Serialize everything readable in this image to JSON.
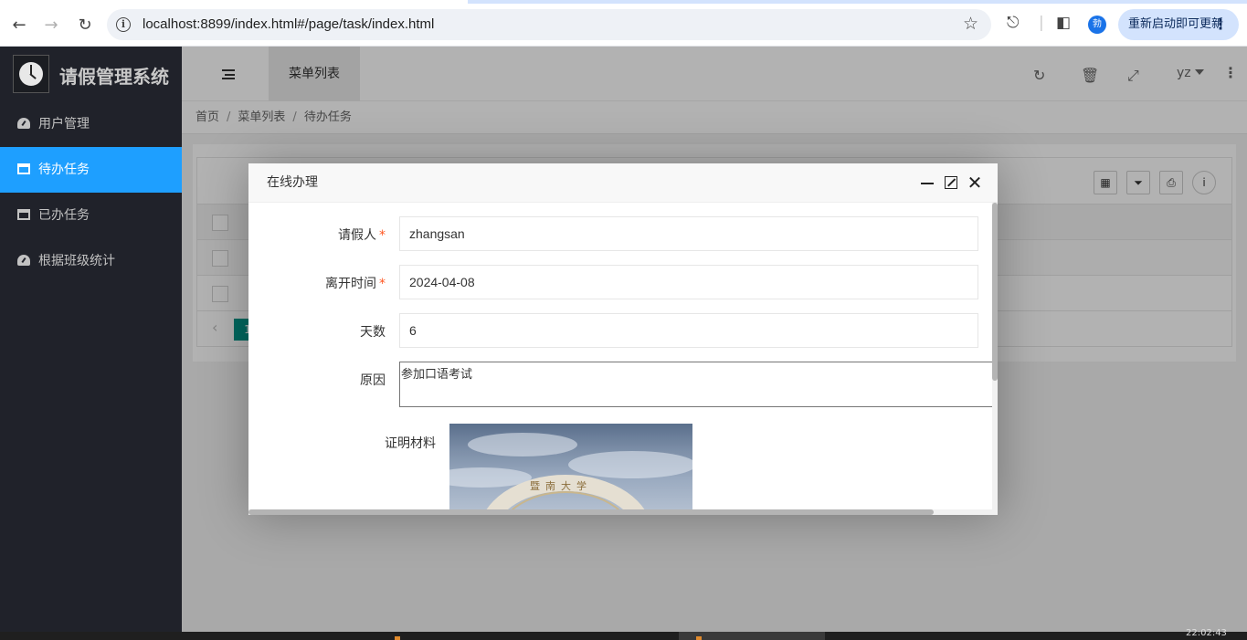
{
  "browser": {
    "url": "localhost:8899/index.html#/page/task/index.html",
    "profile_initial": "勃",
    "update_label": "重新启动即可更新"
  },
  "sidebar": {
    "app_title": "请假管理系统",
    "items": [
      {
        "label": "用户管理",
        "icon": "gauge-icon",
        "active": false
      },
      {
        "label": "待办任务",
        "icon": "window-icon",
        "active": true
      },
      {
        "label": "已办任务",
        "icon": "window-icon",
        "active": false
      },
      {
        "label": "根据班级统计",
        "icon": "gauge-icon",
        "active": false
      }
    ]
  },
  "header": {
    "tab_label": "菜单列表",
    "user": "yz"
  },
  "breadcrumb": [
    "首页",
    "菜单列表",
    "待办任务"
  ],
  "dialog": {
    "title": "在线办理",
    "fields": {
      "applicant": {
        "label": "请假人",
        "value": "zhangsan",
        "required": true
      },
      "leave_time": {
        "label": "离开时间",
        "value": "2024-04-08",
        "required": true
      },
      "days": {
        "label": "天数",
        "value": "6",
        "required": false
      },
      "reason": {
        "label": "原因",
        "value": "参加口语考试",
        "required": false
      },
      "proof": {
        "label": "证明材料"
      }
    },
    "proof_image_text": "暨南大学"
  },
  "pager": {
    "current": "1"
  },
  "taskbar": {
    "time": "22:02:43"
  },
  "colors": {
    "accent": "#1e9fff",
    "sidebar_bg": "#20222a",
    "pager_active": "#009688",
    "required": "#ff5722"
  }
}
